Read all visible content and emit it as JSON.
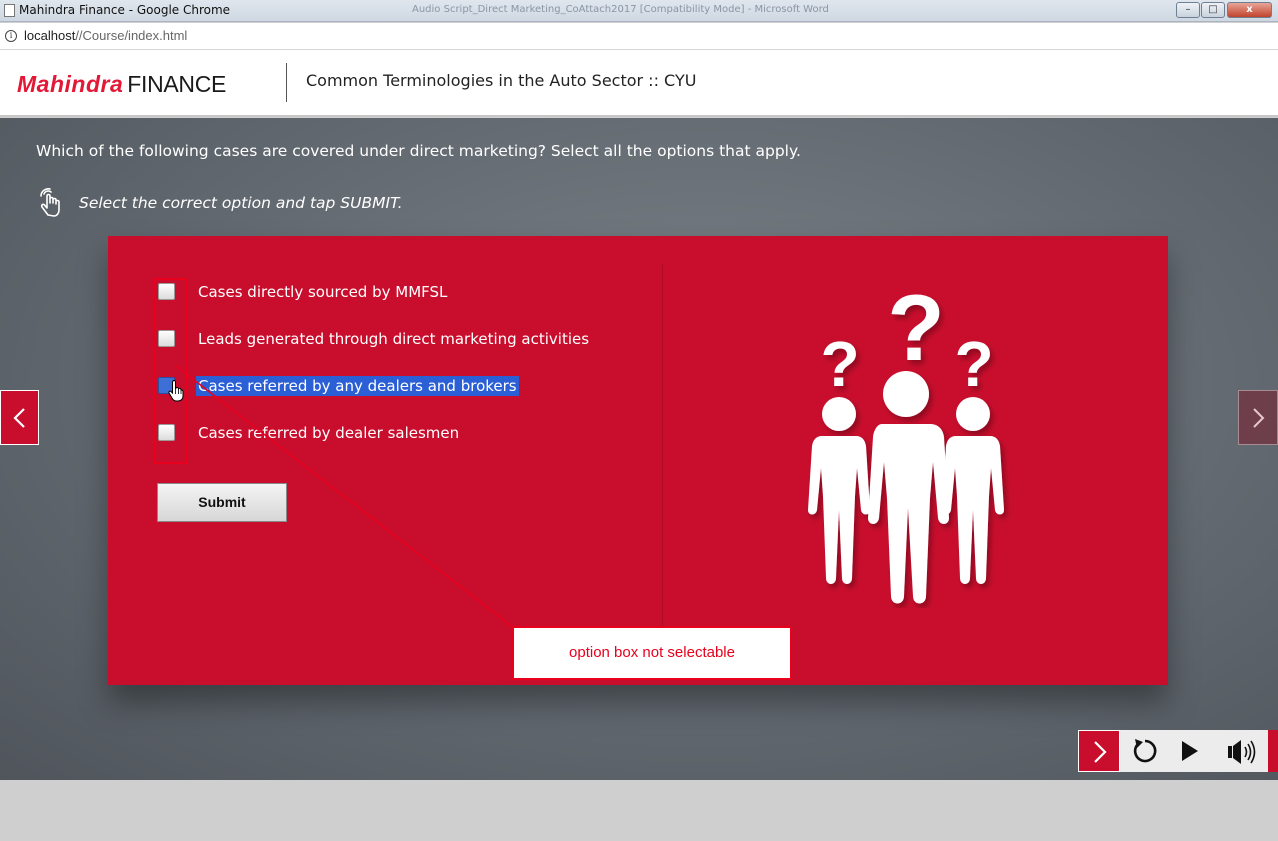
{
  "window": {
    "title": "Mahindra Finance - Google Chrome",
    "background_title": "Audio Script_Direct Marketing_CoAttach2017 [Compatibility Mode] - Microsoft Word",
    "minimize": "–",
    "maximize": "□",
    "close": "x"
  },
  "address": {
    "info_glyph": "i",
    "host": "localhost",
    "path": "//Course/index.html"
  },
  "header": {
    "logo_brand": "Mahindra",
    "logo_product": "FINANCE",
    "course_title": "Common Terminologies in the Auto Sector :: CYU"
  },
  "question": {
    "text": "Which of the following cases are covered under direct marketing? Select all the options that apply.",
    "instruction": "Select the correct option and tap SUBMIT."
  },
  "options": [
    {
      "label": "Cases directly sourced by MMFSL",
      "checked": false
    },
    {
      "label": "Leads generated through direct marketing activities",
      "checked": false
    },
    {
      "label": "Cases referred by any dealers and brokers",
      "checked": true
    },
    {
      "label": "Cases referred by dealer salesmen",
      "checked": false
    }
  ],
  "submit_label": "Submit",
  "annotation": {
    "callout_text": "option box not selectable"
  },
  "colors": {
    "brand_red": "#c90e2d",
    "annotation_red": "#e8001c",
    "selection_blue": "#2a5fd6"
  },
  "icons": {
    "hand": "hand-tap-icon",
    "people": "people-question-icon",
    "prev": "chevron-left-icon",
    "next": "chevron-right-icon",
    "replay": "replay-icon",
    "play": "play-icon",
    "audio": "volume-icon"
  }
}
